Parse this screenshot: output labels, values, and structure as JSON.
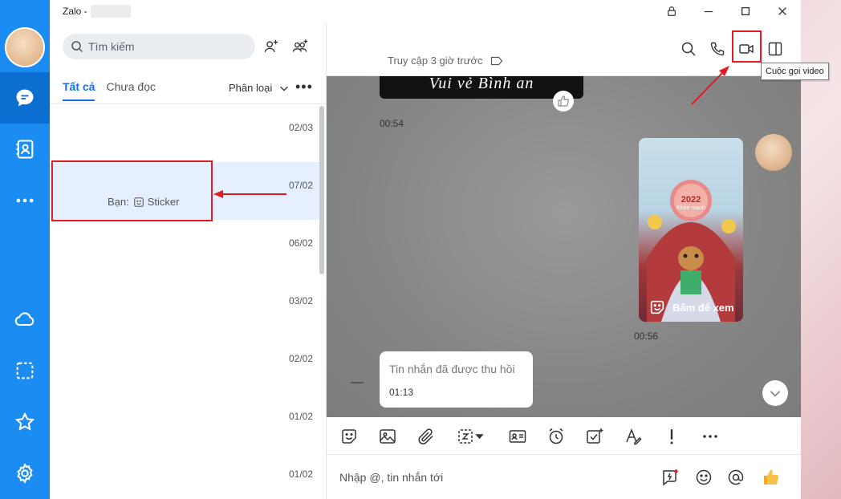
{
  "window": {
    "app_title": "Zalo -"
  },
  "search": {
    "placeholder": "Tìm kiếm"
  },
  "tabs": [
    {
      "label": "Tất cả"
    },
    {
      "label": "Chưa đọc"
    }
  ],
  "filter": {
    "label": "Phân loại",
    "more": "•••"
  },
  "conversations": [
    {
      "time": "02/03",
      "preview_prefix": "",
      "preview": ""
    },
    {
      "time": "07/02",
      "preview_prefix": "Bạn:",
      "preview": "Sticker"
    },
    {
      "time": "06/02",
      "preview_prefix": "",
      "preview": ""
    },
    {
      "time": "03/02",
      "preview_prefix": "",
      "preview": ""
    },
    {
      "time": "02/02",
      "preview_prefix": "",
      "preview": ""
    },
    {
      "time": "01/02",
      "preview_prefix": "",
      "preview": ""
    },
    {
      "time": "01/02",
      "preview_prefix": "",
      "preview": ""
    }
  ],
  "chat_header": {
    "last_access": "Truy cập 3 giờ trước",
    "tooltip": "Cuộc gọi video"
  },
  "messages": {
    "image_caption": "Vui vẻ  Bình an",
    "time_1": "00:54",
    "sticker_year": "2022",
    "sticker_sub": "Khỏe mạnh",
    "sticker_label": "Bấm để xem",
    "time_2": "00:56",
    "recalled_text": "Tin nhắn đã được thu hồi",
    "time_3": "01:13"
  },
  "composer": {
    "placeholder": "Nhập @, tin nhắn tới"
  },
  "colors": {
    "rail": "#1a8cf2",
    "rail_active": "#0a6fd0",
    "accent": "#1a6ee0",
    "annotation": "#e11b22",
    "selected_row": "#e5efff"
  }
}
